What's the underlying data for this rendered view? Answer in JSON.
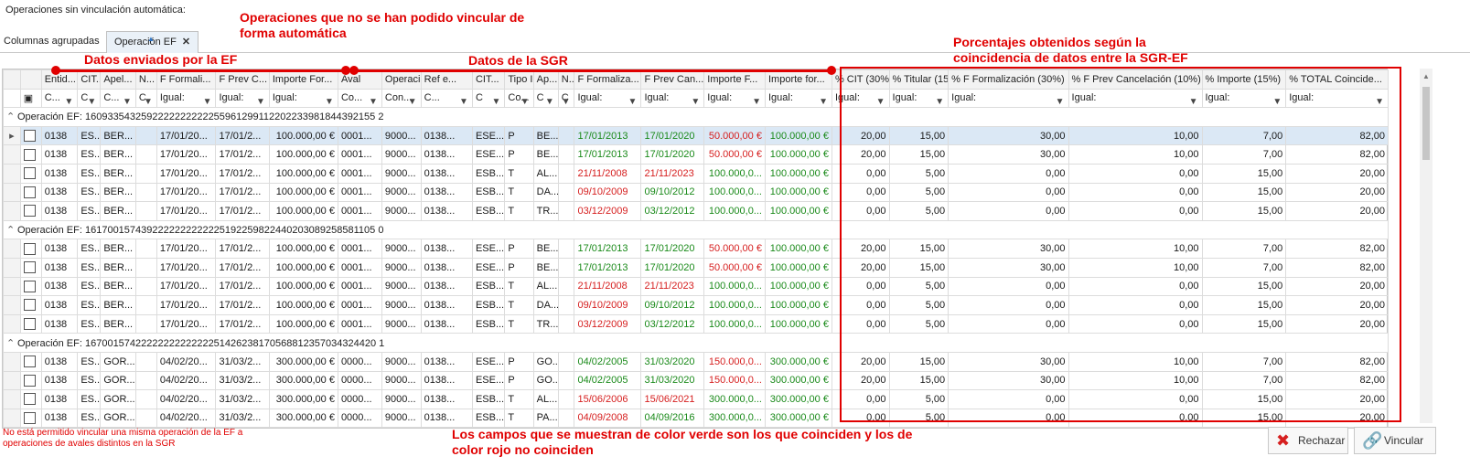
{
  "section_title": "Operaciones sin vinculación automática:",
  "group_panel": {
    "label": "Columnas agrupadas",
    "chip": "Operación EF"
  },
  "columns": [
    "Entid...",
    "CIT...",
    "Apel...",
    "N...",
    "F Formali...",
    "F Prev C...",
    "Importe For...",
    "Aval",
    "Operaci...",
    "Ref e...",
    "CIT...",
    "Tipo I...",
    "Ap...",
    "N...",
    "F Formaliza...",
    "F Prev Can...",
    "Importe F...",
    "Importe for...",
    "% CIT (30%)",
    "% Titular (15%)",
    "% F Formalización (30%)",
    "% F Prev Cancelación (10%)",
    "% Importe (15%)",
    "% TOTAL Coincide..."
  ],
  "filters": [
    "C...",
    "C",
    "C...",
    "C",
    "Igual:",
    "Igual:",
    "Igual:",
    "Co...",
    "Con...",
    "C...",
    "C",
    "Co...",
    "C",
    "C",
    "Igual:",
    "Igual:",
    "Igual:",
    "Igual:",
    "Igual:",
    "Igual:",
    "Igual:",
    "Igual:",
    "Igual:",
    "Igual:"
  ],
  "groups": [
    {
      "title": "Operación EF: 1609335432592222222222255961299112202233981844392155 2",
      "rows": [
        [
          "0138",
          "ES...",
          "BER...",
          "",
          "17/01/20...",
          "17/01/2...",
          "100.000,00 €",
          "0001...",
          "9000...",
          "0138...",
          "ESE...",
          "P",
          "BE...",
          "",
          "17/01/2013",
          "17/01/2020",
          "50.000,00 €",
          "100.000,00 €",
          "20,00",
          "15,00",
          "30,00",
          "10,00",
          "7,00",
          "82,00"
        ],
        [
          "0138",
          "ES...",
          "BER...",
          "",
          "17/01/20...",
          "17/01/2...",
          "100.000,00 €",
          "0001...",
          "9000...",
          "0138...",
          "ESE...",
          "P",
          "BE...",
          "",
          "17/01/2013",
          "17/01/2020",
          "50.000,00 €",
          "100.000,00 €",
          "20,00",
          "15,00",
          "30,00",
          "10,00",
          "7,00",
          "82,00"
        ],
        [
          "0138",
          "ES...",
          "BER...",
          "",
          "17/01/20...",
          "17/01/2...",
          "100.000,00 €",
          "0001...",
          "9000...",
          "0138...",
          "ESB...",
          "T",
          "AL...",
          "",
          "21/11/2008",
          "21/11/2023",
          "100.000,0...",
          "100.000,00 €",
          "0,00",
          "5,00",
          "0,00",
          "0,00",
          "15,00",
          "20,00"
        ],
        [
          "0138",
          "ES...",
          "BER...",
          "",
          "17/01/20...",
          "17/01/2...",
          "100.000,00 €",
          "0001...",
          "9000...",
          "0138...",
          "ESB...",
          "T",
          "DA...",
          "",
          "09/10/2009",
          "09/10/2012",
          "100.000,0...",
          "100.000,00 €",
          "0,00",
          "5,00",
          "0,00",
          "0,00",
          "15,00",
          "20,00"
        ],
        [
          "0138",
          "ES...",
          "BER...",
          "",
          "17/01/20...",
          "17/01/2...",
          "100.000,00 €",
          "0001...",
          "9000...",
          "0138...",
          "ESB...",
          "T",
          "TR...",
          "",
          "03/12/2009",
          "03/12/2012",
          "100.000,0...",
          "100.000,00 €",
          "0,00",
          "5,00",
          "0,00",
          "0,00",
          "15,00",
          "20,00"
        ]
      ]
    },
    {
      "title": "Operación EF: 1617001574392222222222225192259822440203089258581105 0",
      "rows": [
        [
          "0138",
          "ES...",
          "BER...",
          "",
          "17/01/20...",
          "17/01/2...",
          "100.000,00 €",
          "0001...",
          "9000...",
          "0138...",
          "ESE...",
          "P",
          "BE...",
          "",
          "17/01/2013",
          "17/01/2020",
          "50.000,00 €",
          "100.000,00 €",
          "20,00",
          "15,00",
          "30,00",
          "10,00",
          "7,00",
          "82,00"
        ],
        [
          "0138",
          "ES...",
          "BER...",
          "",
          "17/01/20...",
          "17/01/2...",
          "100.000,00 €",
          "0001...",
          "9000...",
          "0138...",
          "ESE...",
          "P",
          "BE...",
          "",
          "17/01/2013",
          "17/01/2020",
          "50.000,00 €",
          "100.000,00 €",
          "20,00",
          "15,00",
          "30,00",
          "10,00",
          "7,00",
          "82,00"
        ],
        [
          "0138",
          "ES...",
          "BER...",
          "",
          "17/01/20...",
          "17/01/2...",
          "100.000,00 €",
          "0001...",
          "9000...",
          "0138...",
          "ESB...",
          "T",
          "AL...",
          "",
          "21/11/2008",
          "21/11/2023",
          "100.000,0...",
          "100.000,00 €",
          "0,00",
          "5,00",
          "0,00",
          "0,00",
          "15,00",
          "20,00"
        ],
        [
          "0138",
          "ES...",
          "BER...",
          "",
          "17/01/20...",
          "17/01/2...",
          "100.000,00 €",
          "0001...",
          "9000...",
          "0138...",
          "ESB...",
          "T",
          "DA...",
          "",
          "09/10/2009",
          "09/10/2012",
          "100.000,0...",
          "100.000,00 €",
          "0,00",
          "5,00",
          "0,00",
          "0,00",
          "15,00",
          "20,00"
        ],
        [
          "0138",
          "ES...",
          "BER...",
          "",
          "17/01/20...",
          "17/01/2...",
          "100.000,00 €",
          "0001...",
          "9000...",
          "0138...",
          "ESB...",
          "T",
          "TR...",
          "",
          "03/12/2009",
          "03/12/2012",
          "100.000,0...",
          "100.000,00 €",
          "0,00",
          "5,00",
          "0,00",
          "0,00",
          "15,00",
          "20,00"
        ]
      ]
    },
    {
      "title": "Operación EF: 1670015742222222222222251426238170568812357034324420 1",
      "rows": [
        [
          "0138",
          "ES...",
          "GOR...",
          "",
          "04/02/20...",
          "31/03/2...",
          "300.000,00 €",
          "0000...",
          "9000...",
          "0138...",
          "ESE...",
          "P",
          "GO...",
          "",
          "04/02/2005",
          "31/03/2020",
          "150.000,0...",
          "300.000,00 €",
          "20,00",
          "15,00",
          "30,00",
          "10,00",
          "7,00",
          "82,00"
        ],
        [
          "0138",
          "ES...",
          "GOR...",
          "",
          "04/02/20...",
          "31/03/2...",
          "300.000,00 €",
          "0000...",
          "9000...",
          "0138...",
          "ESE...",
          "P",
          "GO...",
          "",
          "04/02/2005",
          "31/03/2020",
          "150.000,0...",
          "300.000,00 €",
          "20,00",
          "15,00",
          "30,00",
          "10,00",
          "7,00",
          "82,00"
        ],
        [
          "0138",
          "ES...",
          "GOR...",
          "",
          "04/02/20...",
          "31/03/2...",
          "300.000,00 €",
          "0000...",
          "9000...",
          "0138...",
          "ESB...",
          "T",
          "AL...",
          "",
          "15/06/2006",
          "15/06/2021",
          "300.000,0...",
          "300.000,00 €",
          "0,00",
          "5,00",
          "0,00",
          "0,00",
          "15,00",
          "20,00"
        ],
        [
          "0138",
          "ES...",
          "GOR...",
          "",
          "04/02/20...",
          "31/03/2...",
          "300.000,00 €",
          "0000...",
          "9000...",
          "0138...",
          "ESB...",
          "T",
          "PA...",
          "",
          "04/09/2008",
          "04/09/2016",
          "300.000,0...",
          "300.000,00 €",
          "0,00",
          "5,00",
          "0,00",
          "0,00",
          "15,00",
          "20,00"
        ]
      ]
    }
  ],
  "annotations": {
    "no_auto_link": "Operaciones que no se han podido vincular de forma automática",
    "sent_by_ef": "Datos enviados por la EF",
    "sgr_data": "Datos de la SGR",
    "percentages": "Porcentajes obtenidos según la coincidencia de datos entre la SGR-EF",
    "colors_note": "Los campos que se muestran de color verde son los que coinciden y los de color rojo no coinciden",
    "warning": "No está permitido vincular una misma operación de la EF a operaciones de avales distintos en la SGR"
  },
  "buttons": {
    "reject": "Rechazar",
    "link": "Vincular"
  },
  "colors": {
    "match": "#1a8a1a",
    "mismatch": "#d62020",
    "annotation": "#e00000",
    "selected_row": "#dbe8f5"
  }
}
